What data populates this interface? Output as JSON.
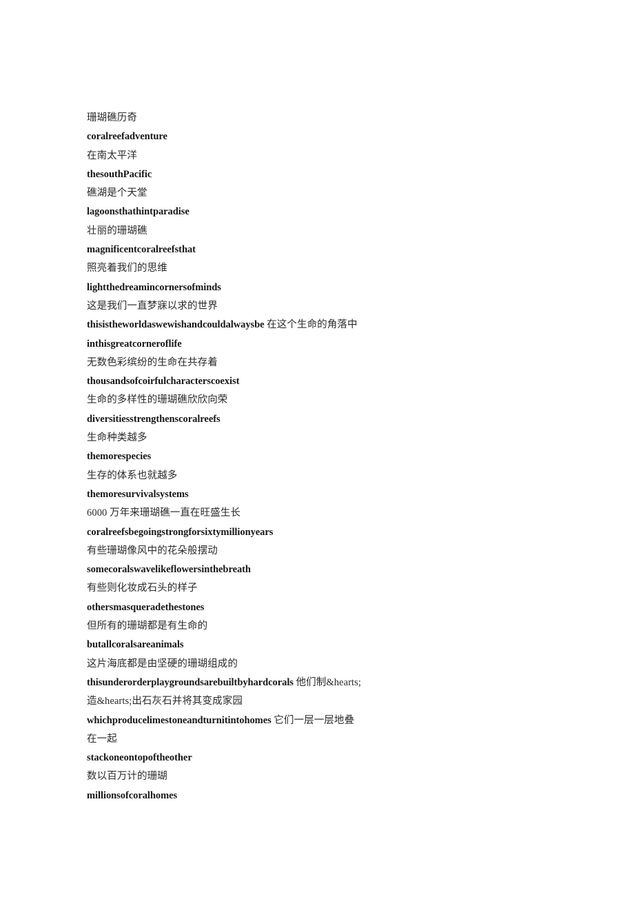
{
  "document": {
    "background_color": "#ffffff",
    "text_color_zh": "#2b2b2b",
    "text_color_en": "#181818",
    "lines": [
      {
        "id": "l1",
        "kind": "zh",
        "text": "珊瑚礁历奇"
      },
      {
        "id": "l2",
        "kind": "en",
        "text": "coralreefadventure"
      },
      {
        "id": "l3",
        "kind": "zh",
        "text": "在南太平洋"
      },
      {
        "id": "l4",
        "kind": "en",
        "text": "thesouthPacific"
      },
      {
        "id": "l5",
        "kind": "zh",
        "text": "礁湖是个天堂"
      },
      {
        "id": "l6",
        "kind": "en",
        "text": "lagoonsthathintparadise"
      },
      {
        "id": "l7",
        "kind": "zh",
        "text": "壮丽的珊瑚礁"
      },
      {
        "id": "l8",
        "kind": "en",
        "text": "magnificentcoralreefsthat"
      },
      {
        "id": "l9",
        "kind": "zh",
        "text": "照亮着我们的思维"
      },
      {
        "id": "l10",
        "kind": "en",
        "text": "lightthedreamincornersofminds"
      },
      {
        "id": "l11",
        "kind": "zh",
        "text": "这是我们一直梦寐以求的世界"
      },
      {
        "id": "l12",
        "kind": "mixed",
        "en_run": "thisistheworldaswewishandcouldalwaysbe",
        "zh_run": "在这个生命的角落中"
      },
      {
        "id": "l13",
        "kind": "en",
        "text": "inthisgreatcorneroflife"
      },
      {
        "id": "l14",
        "kind": "zh",
        "text": "无数色彩缤纷的生命在共存着"
      },
      {
        "id": "l15",
        "kind": "en",
        "text": "thousandsofcoirfulcharacterscoexist"
      },
      {
        "id": "l16",
        "kind": "zh",
        "text": "生命的多样性的珊瑚礁欣欣向荣"
      },
      {
        "id": "l17",
        "kind": "en",
        "text": "diversitiesstrengthenscoralreefs"
      },
      {
        "id": "l18",
        "kind": "zh",
        "text": "生命种类越多"
      },
      {
        "id": "l19",
        "kind": "en",
        "text": "themorespecies"
      },
      {
        "id": "l20",
        "kind": "zh",
        "text": "生存的体系也就越多"
      },
      {
        "id": "l21",
        "kind": "en",
        "text": "themoresurvivalsystems"
      },
      {
        "id": "l22",
        "kind": "zh",
        "text": "6000 万年来珊瑚礁一直在旺盛生长"
      },
      {
        "id": "l23",
        "kind": "en",
        "text": "coralreefsbegoingstrongforsixtymillionyears"
      },
      {
        "id": "l24",
        "kind": "zh",
        "text": "有些珊瑚像风中的花朵般摆动"
      },
      {
        "id": "l25",
        "kind": "en",
        "text": "somecoralswavelikeflowersinthebreath"
      },
      {
        "id": "l26",
        "kind": "zh",
        "text": "有些则化妆成石头的样子"
      },
      {
        "id": "l27",
        "kind": "en",
        "text": "othersmasqueradethestones"
      },
      {
        "id": "l28",
        "kind": "zh",
        "text": "但所有的珊瑚都是有生命的"
      },
      {
        "id": "l29",
        "kind": "en",
        "text": "butallcoralsareanimals"
      },
      {
        "id": "l30",
        "kind": "zh",
        "text": "这片海底都是由坚硬的珊瑚组成的"
      },
      {
        "id": "l31",
        "kind": "mixed",
        "en_run": "thisunderorderplaygroundsarebuiltbyhardcorals",
        "zh_run": "他们制&hearts;造&hearts;出石灰石并将其变成家园"
      },
      {
        "id": "l32",
        "kind": "mixed",
        "en_run": "whichproducelimestoneandturnitintohomes",
        "zh_run": "它们一层一层地叠在一起"
      },
      {
        "id": "l33",
        "kind": "en",
        "text": "stackoneontopoftheother"
      },
      {
        "id": "l34",
        "kind": "zh",
        "text": "数以百万计的珊瑚"
      },
      {
        "id": "l35",
        "kind": "en",
        "text": "millionsofcoralhomes"
      }
    ]
  }
}
